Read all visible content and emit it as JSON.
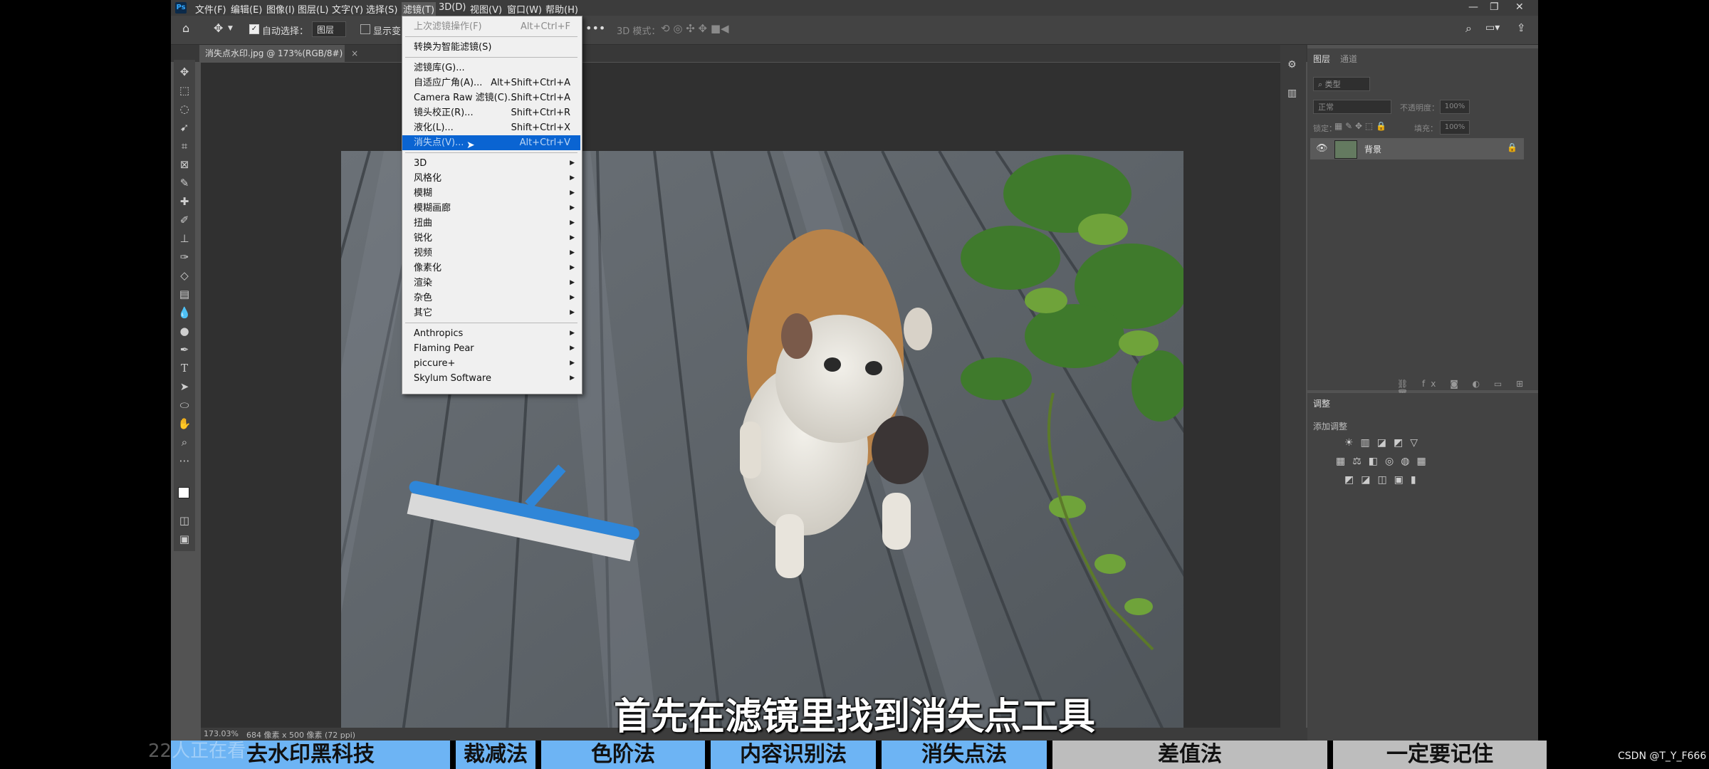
{
  "menubar": {
    "items": [
      "文件(F)",
      "编辑(E)",
      "图像(I)",
      "图层(L)",
      "文字(Y)",
      "选择(S)",
      "滤镜(T)",
      "3D(D)",
      "视图(V)",
      "窗口(W)",
      "帮助(H)"
    ],
    "active": "滤镜(T)"
  },
  "options_bar": {
    "auto_select_label": "自动选择：",
    "auto_select_value": "图层",
    "show_transform": "显示变",
    "mode_3d": "3D 模式："
  },
  "document_tab": {
    "title": "消失点水印.jpg @ 173%(RGB/8#)"
  },
  "status": {
    "zoom": "173.03%",
    "doc_size": "684 像素 x 500 像素 (72 ppi)"
  },
  "filter_menu": {
    "items": [
      {
        "label": "上次滤镜操作(F)",
        "shortcut": "Alt+Ctrl+F",
        "disabled": true
      },
      {
        "sep": true
      },
      {
        "label": "转换为智能滤镜(S)"
      },
      {
        "sep": true
      },
      {
        "label": "滤镜库(G)..."
      },
      {
        "label": "自适应广角(A)...",
        "shortcut": "Alt+Shift+Ctrl+A"
      },
      {
        "label": "Camera Raw 滤镜(C)...",
        "shortcut": "Shift+Ctrl+A"
      },
      {
        "label": "镜头校正(R)...",
        "shortcut": "Shift+Ctrl+R"
      },
      {
        "label": "液化(L)...",
        "shortcut": "Shift+Ctrl+X"
      },
      {
        "label": "消失点(V)...",
        "shortcut": "Alt+Ctrl+V",
        "selected": true
      },
      {
        "sep": true
      },
      {
        "label": "3D",
        "submenu": true
      },
      {
        "label": "风格化",
        "submenu": true
      },
      {
        "label": "模糊",
        "submenu": true
      },
      {
        "label": "模糊画廊",
        "submenu": true
      },
      {
        "label": "扭曲",
        "submenu": true
      },
      {
        "label": "锐化",
        "submenu": true
      },
      {
        "label": "视频",
        "submenu": true
      },
      {
        "label": "像素化",
        "submenu": true
      },
      {
        "label": "渲染",
        "submenu": true
      },
      {
        "label": "杂色",
        "submenu": true
      },
      {
        "label": "其它",
        "submenu": true
      },
      {
        "sep": true
      },
      {
        "label": "Anthropics",
        "submenu": true
      },
      {
        "label": "Flaming Pear",
        "submenu": true
      },
      {
        "label": "piccure+",
        "submenu": true
      },
      {
        "label": "Skylum Software",
        "submenu": true
      }
    ]
  },
  "layers_panel": {
    "tabs": [
      "图层",
      "通道"
    ],
    "search_placeholder": "类型",
    "blend_mode": "正常",
    "opacity_label": "不透明度：",
    "opacity_value": "100%",
    "lock_label": "锁定：",
    "fill_label": "填充：",
    "fill_value": "100%",
    "layer_name": "背景"
  },
  "adjustments_panel": {
    "tab": "调整",
    "subtitle": "添加调整"
  },
  "subtitle": "首先在滤镜里找到消失点工具",
  "bottom_bar": {
    "segments": [
      {
        "label": "去水印黑科技",
        "color": "#6db4f4"
      },
      {
        "label": "裁减法",
        "color": "#6db4f4"
      },
      {
        "label": "色阶法",
        "color": "#6db4f4"
      },
      {
        "label": "内容识别法",
        "color": "#6db4f4"
      },
      {
        "label": "消失点法",
        "color": "#6db4f4"
      },
      {
        "label": "差值法",
        "color": "#bdbdbd"
      },
      {
        "label": "一定要记住",
        "color": "#bdbdbd"
      }
    ]
  },
  "watermark": "22人正在看",
  "credit": "CSDN @T_Y_F666",
  "icons": [
    "home-icon",
    "move-icon",
    "search-icon",
    "workspace-icon",
    "share-icon",
    "eye-icon",
    "lock-icon"
  ]
}
